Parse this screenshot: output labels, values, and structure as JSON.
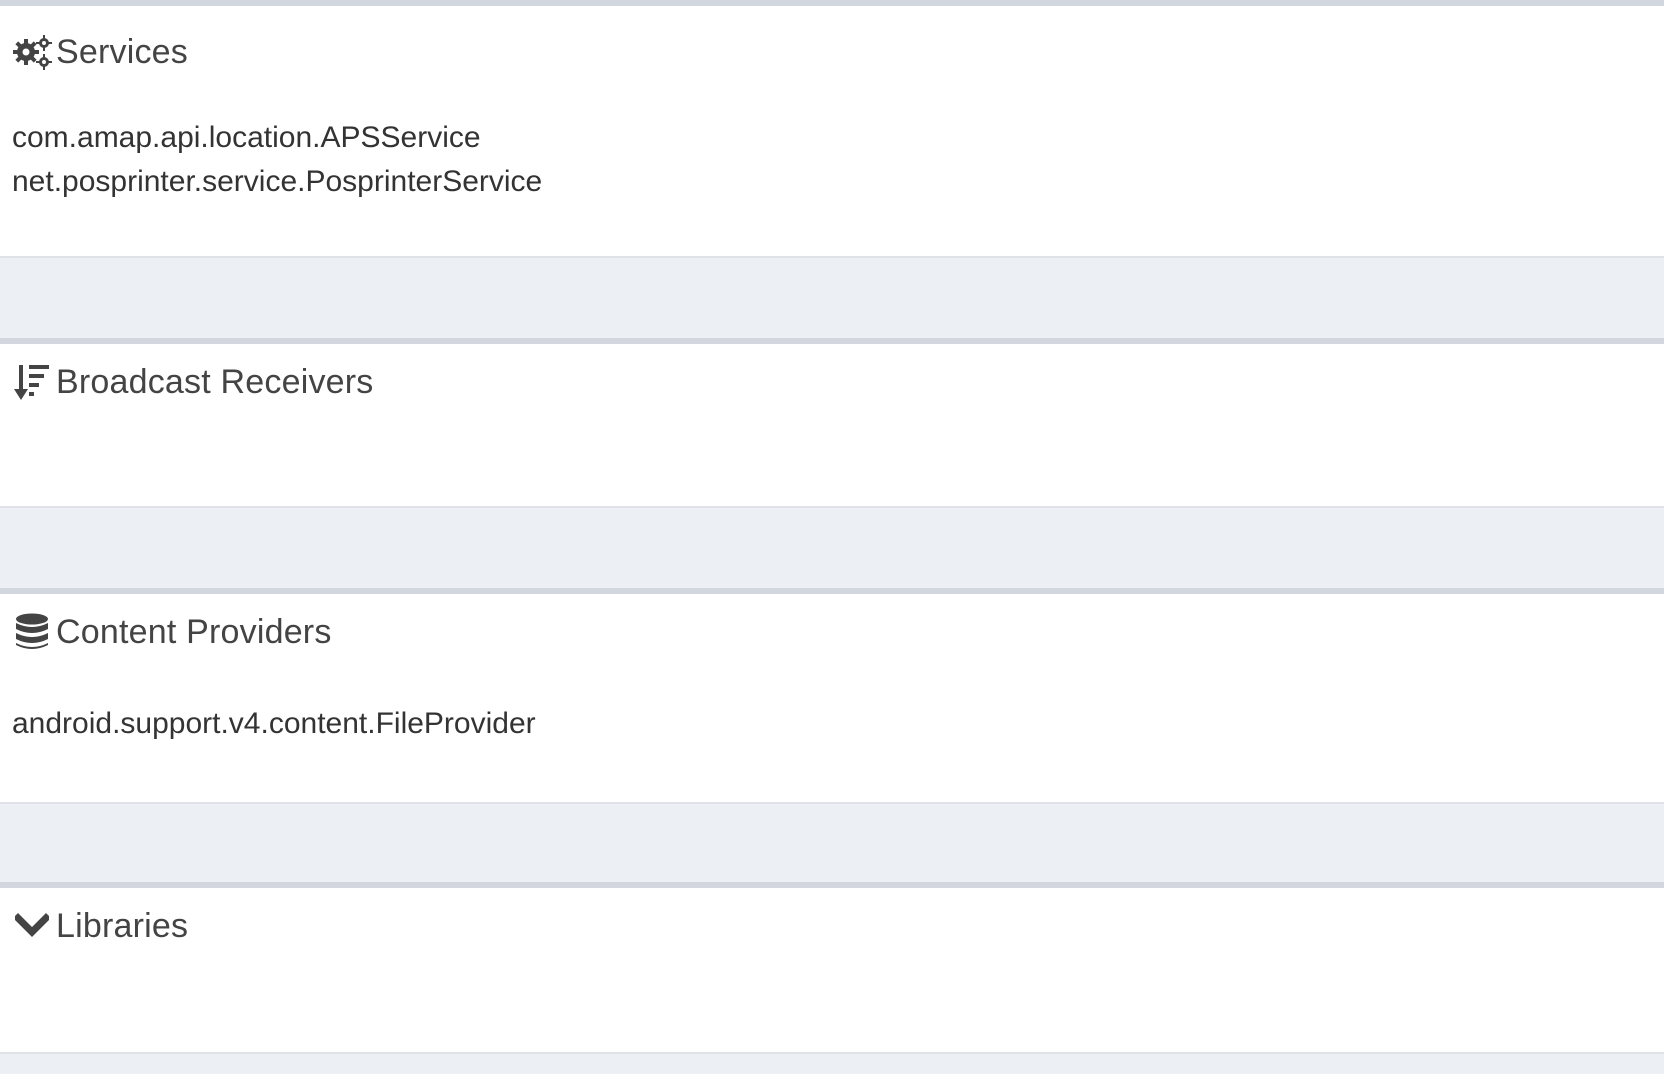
{
  "sections": {
    "services": {
      "title": "Services",
      "icon": "cogs-icon",
      "items": [
        "com.amap.api.location.APSService",
        "net.posprinter.service.PosprinterService"
      ]
    },
    "receivers": {
      "title": "Broadcast Receivers",
      "icon": "sort-amount-down-icon",
      "items": []
    },
    "providers": {
      "title": "Content Providers",
      "icon": "database-icon",
      "items": [
        "android.support.v4.content.FileProvider"
      ]
    },
    "libraries": {
      "title": "Libraries",
      "icon": "chevron-down-icon",
      "items": []
    }
  },
  "colors": {
    "page_background": "#ecf0f5",
    "box_background": "#ffffff",
    "box_border": "#d2d6de",
    "text": "#333333"
  }
}
